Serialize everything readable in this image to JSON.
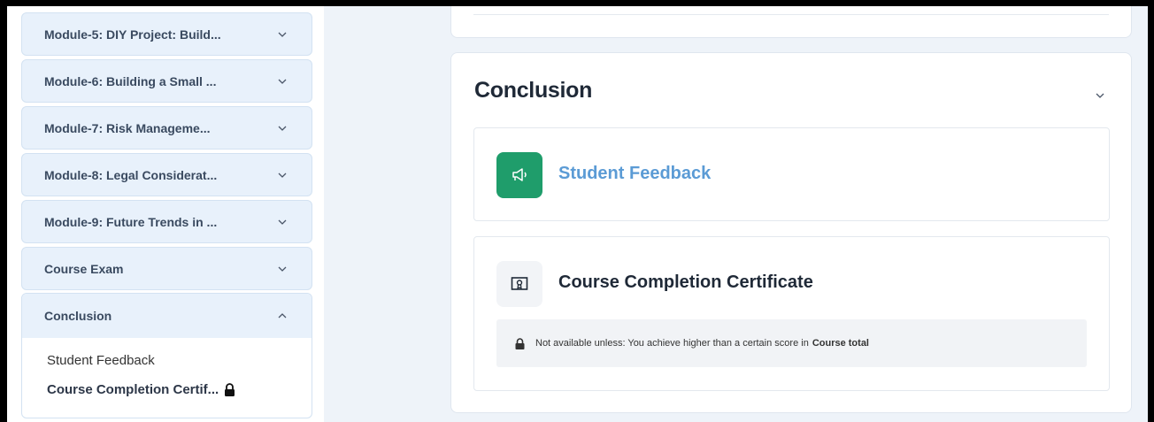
{
  "sidebar": {
    "modules": [
      {
        "label": "Module-5: DIY Project: Build..."
      },
      {
        "label": "Module-6: Building a Small ..."
      },
      {
        "label": "Module-7: Risk Manageme..."
      },
      {
        "label": "Module-8: Legal Considerat..."
      },
      {
        "label": "Module-9: Future Trends in ..."
      },
      {
        "label": "Course Exam"
      }
    ],
    "conclusion": {
      "label": "Conclusion",
      "items": [
        {
          "label": "Student Feedback"
        },
        {
          "label": "Course Completion Certif..."
        }
      ]
    }
  },
  "main": {
    "section_title": "Conclusion",
    "activities": {
      "feedback": {
        "title": "Student Feedback",
        "icon": "megaphone-icon"
      },
      "certificate": {
        "title": "Course Completion Certificate",
        "icon": "certificate-icon",
        "restriction_text": "Not available unless: You achieve higher than a certain score in",
        "restriction_bold": "Course total"
      }
    }
  },
  "colors": {
    "accent_link": "#5b9bd5",
    "feedback_icon_bg": "#1f9d6b",
    "module_bg": "#e8f1fb",
    "page_bg": "#eef3f9"
  }
}
